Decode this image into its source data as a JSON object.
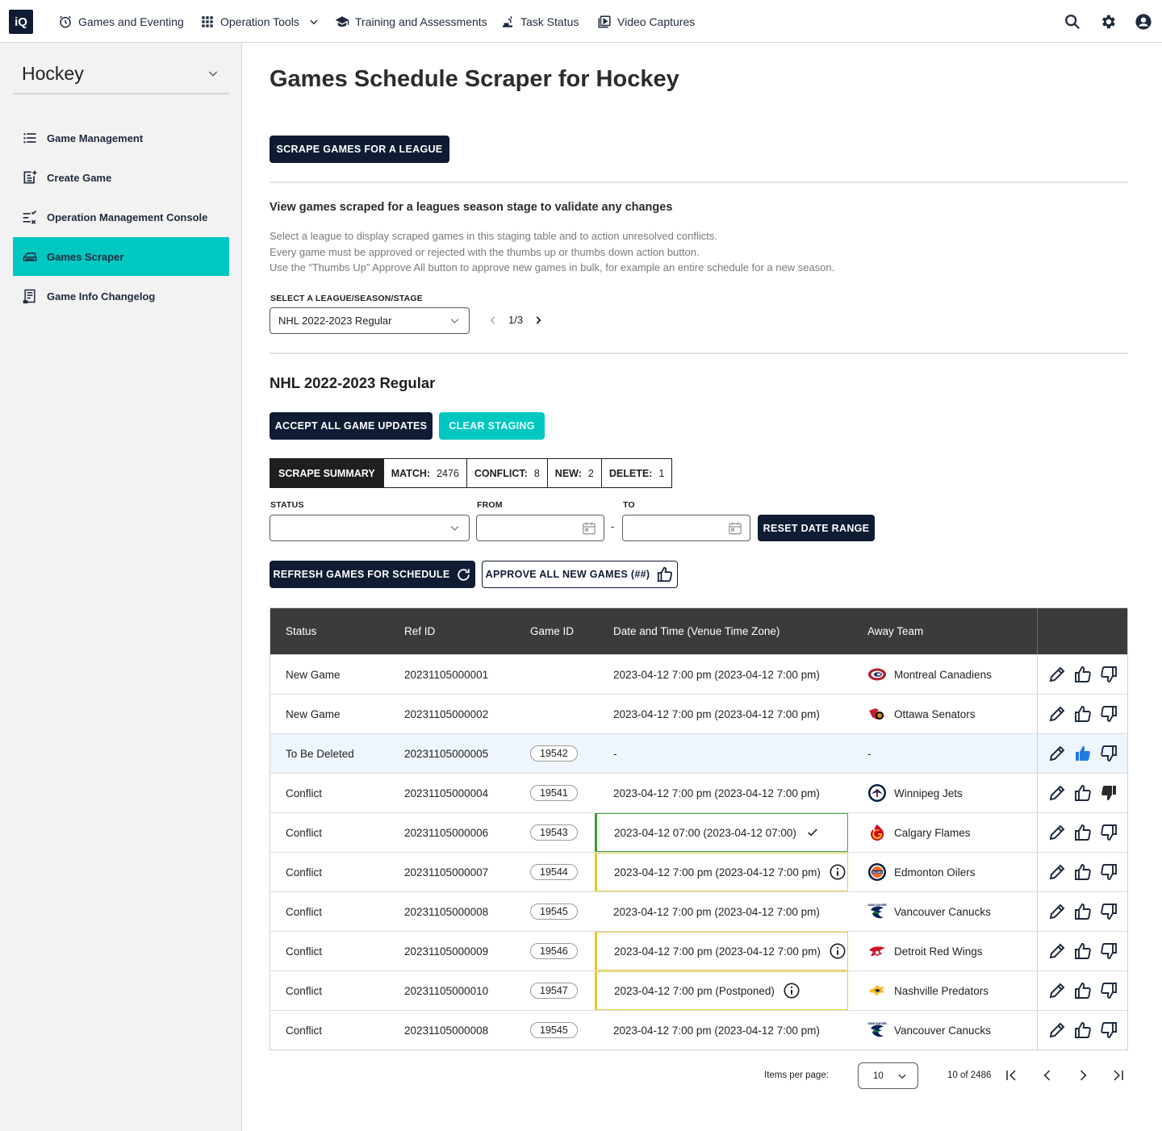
{
  "topnav": {
    "logo": "iQ",
    "items": [
      {
        "label": "Games and Eventing",
        "icon": "alarm-clock-icon"
      },
      {
        "label": "Operation Tools",
        "icon": "grid-icon"
      },
      {
        "label": "Training and Assessments",
        "icon": "graduation-cap-icon"
      },
      {
        "label": "Task Status",
        "icon": "crane-icon"
      },
      {
        "label": "Video Captures",
        "icon": "video-play-icon"
      }
    ],
    "right_icons": [
      "search-icon",
      "gear-icon",
      "account-icon"
    ]
  },
  "sidebar": {
    "sport": "Hockey",
    "items": [
      {
        "label": "Game Management",
        "icon": "list-icon"
      },
      {
        "label": "Create Game",
        "icon": "create-document-icon"
      },
      {
        "label": "Operation Management Console",
        "icon": "checklist-icon"
      },
      {
        "label": "Games Scraper",
        "icon": "scraper-icon",
        "active": true
      },
      {
        "label": "Game Info Changelog",
        "icon": "changelog-icon"
      }
    ]
  },
  "main": {
    "title": "Games Schedule Scraper for Hockey",
    "scrape_button": "SCRAPE GAMES FOR A LEAGUE",
    "subtitle": "View games scraped for a leagues season stage to validate any changes",
    "description": [
      "Select a league to display scraped games in this staging table and to action unresolved conflicts.",
      "Every game must be approved or rejected with the thumbs up or thumbs down action button.",
      "Use the “Thumbs Up” Approve All button to approve new games in bulk, for example an entire schedule for a new season."
    ],
    "league_select_label": "SELECT A LEAGUE/SEASON/STAGE",
    "league_select_value": "NHL 2022-2023 Regular",
    "league_pager": "1/3",
    "section_title": "NHL 2022-2023 Regular",
    "accept_all_button": "ACCEPT ALL GAME UPDATES",
    "clear_staging_button": "CLEAR STAGING",
    "summary": {
      "head": "SCRAPE SUMMARY",
      "match_label": "MATCH:",
      "match": "2476",
      "conflict_label": "CONFLICT:",
      "conflict": "8",
      "new_label": "NEW:",
      "new": "2",
      "delete_label": "DELETE:",
      "delete": "1"
    },
    "filters": {
      "status_label": "STATUS",
      "from_label": "FROM",
      "to_label": "TO",
      "separator": "-",
      "reset_button": "RESET DATE RANGE"
    },
    "refresh_button": "REFRESH GAMES FOR SCHEDULE",
    "approve_all_button": "APPROVE ALL NEW GAMES (##)"
  },
  "table": {
    "headers": [
      "Status",
      "Ref ID",
      "Game ID",
      "Date and Time (Venue Time Zone)",
      "Away Team"
    ],
    "rows": [
      {
        "status": "New Game",
        "ref": "20231105000001",
        "game": "",
        "date": "2023-04-12 7:00 pm (2023-04-12 7:00 pm)",
        "flag": "",
        "team": "Montreal Canadiens",
        "logo": "montreal-logo-icon",
        "thumb_up": "outline",
        "thumb_down": "outline",
        "highlight": false
      },
      {
        "status": "New Game",
        "ref": "20231105000002",
        "game": "",
        "date": "2023-04-12 7:00 pm (2023-04-12 7:00 pm)",
        "flag": "",
        "team": "Ottawa Senators",
        "logo": "ottawa-logo-icon",
        "thumb_up": "outline",
        "thumb_down": "outline",
        "highlight": false
      },
      {
        "status": "To Be Deleted",
        "ref": "20231105000005",
        "game": "19542",
        "date": "-",
        "flag": "",
        "team": "-",
        "logo": "",
        "thumb_up": "filled-blue",
        "thumb_down": "outline",
        "highlight": true
      },
      {
        "status": "Conflict",
        "ref": "20231105000004",
        "game": "19541",
        "date": "2023-04-12 7:00 pm (2023-04-12 7:00 pm)",
        "flag": "",
        "team": "Winnipeg Jets",
        "logo": "winnipeg-logo-icon",
        "thumb_up": "outline",
        "thumb_down": "filled-dark",
        "highlight": false
      },
      {
        "status": "Conflict",
        "ref": "20231105000006",
        "game": "19543",
        "date": "2023-04-12 07:00 (2023-04-12 07:00)",
        "flag": "ok",
        "team": "Calgary Flames",
        "logo": "calgary-logo-icon",
        "thumb_up": "outline",
        "thumb_down": "outline",
        "highlight": false
      },
      {
        "status": "Conflict",
        "ref": "20231105000007",
        "game": "19544",
        "date": "2023-04-12 7:00 pm (2023-04-12 7:00 pm)",
        "flag": "warn",
        "team": "Edmonton Oilers",
        "logo": "edmonton-logo-icon",
        "thumb_up": "outline",
        "thumb_down": "outline",
        "highlight": false
      },
      {
        "status": "Conflict",
        "ref": "20231105000008",
        "game": "19545",
        "date": "2023-04-12 7:00 pm (2023-04-12 7:00 pm)",
        "flag": "",
        "team": "Vancouver Canucks",
        "logo": "vancouver-logo-icon",
        "thumb_up": "outline",
        "thumb_down": "outline",
        "highlight": false
      },
      {
        "status": "Conflict",
        "ref": "20231105000009",
        "game": "19546",
        "date": "2023-04-12 7:00 pm (2023-04-12 7:00 pm)",
        "flag": "warn",
        "team": "Detroit Red Wings",
        "logo": "detroit-logo-icon",
        "thumb_up": "outline",
        "thumb_down": "outline",
        "highlight": false
      },
      {
        "status": "Conflict",
        "ref": "20231105000010",
        "game": "19547",
        "date": "2023-04-12 7:00 pm (Postponed)",
        "flag": "warn",
        "team": "Nashville Predators",
        "logo": "nashville-logo-icon",
        "thumb_up": "outline",
        "thumb_down": "outline",
        "highlight": false
      },
      {
        "status": "Conflict",
        "ref": "20231105000008",
        "game": "19545",
        "date": "2023-04-12 7:00 pm (2023-04-12 7:00 pm)",
        "flag": "",
        "team": "Vancouver Canucks",
        "logo": "vancouver-logo-icon",
        "thumb_up": "outline",
        "thumb_down": "outline",
        "highlight": false
      }
    ]
  },
  "pagination": {
    "items_per_page_label": "Items per page:",
    "items_per_page": "10",
    "range": "10 of 2486"
  },
  "colors": {
    "navy": "#0f1c33",
    "teal": "#00c7c0",
    "header_gray": "#3b3b3b",
    "ok_green": "#3b9a36",
    "warn_yellow": "#e5cb21",
    "thumb_blue": "#1f7ae0"
  }
}
